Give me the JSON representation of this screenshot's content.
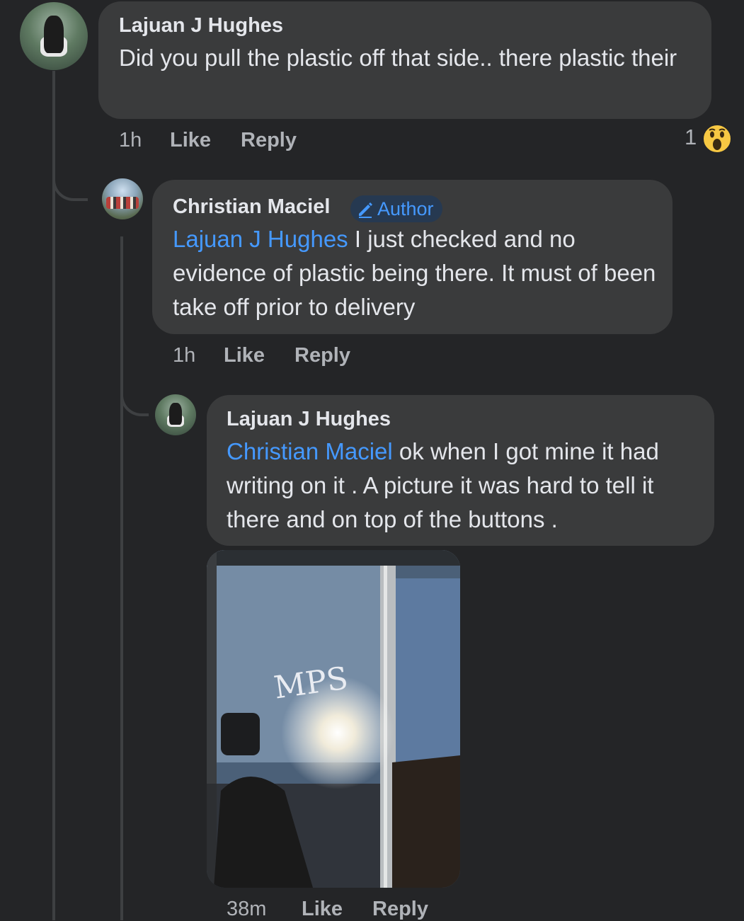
{
  "comments": [
    {
      "author": "Lajuan J Hughes",
      "text": "Did you pull the plastic off that side.. there plastic their",
      "time": "1h",
      "like_label": "Like",
      "reply_label": "Reply",
      "reaction_count": "1",
      "reaction_icon": "wow-reaction-icon"
    },
    {
      "author": "Christian Maciel",
      "badge": "Author",
      "mention": "Lajuan J Hughes",
      "text": " I just checked and no evidence of plastic being there. It must of been take off prior to delivery",
      "time": "1h",
      "like_label": "Like",
      "reply_label": "Reply"
    },
    {
      "author": "Lajuan J Hughes",
      "mention": "Christian Maciel",
      "text": " ok when I got mine it had writing on it . A picture it was  hard to tell it there and on top of the buttons .",
      "time": "38m",
      "like_label": "Like",
      "reply_label": "Reply",
      "photo_writing": "MPS"
    }
  ],
  "colors": {
    "background": "#242527",
    "bubble": "#3a3b3c",
    "mention": "#4599ff",
    "meta": "#b0b3b8",
    "badge_bg": "#263951"
  }
}
